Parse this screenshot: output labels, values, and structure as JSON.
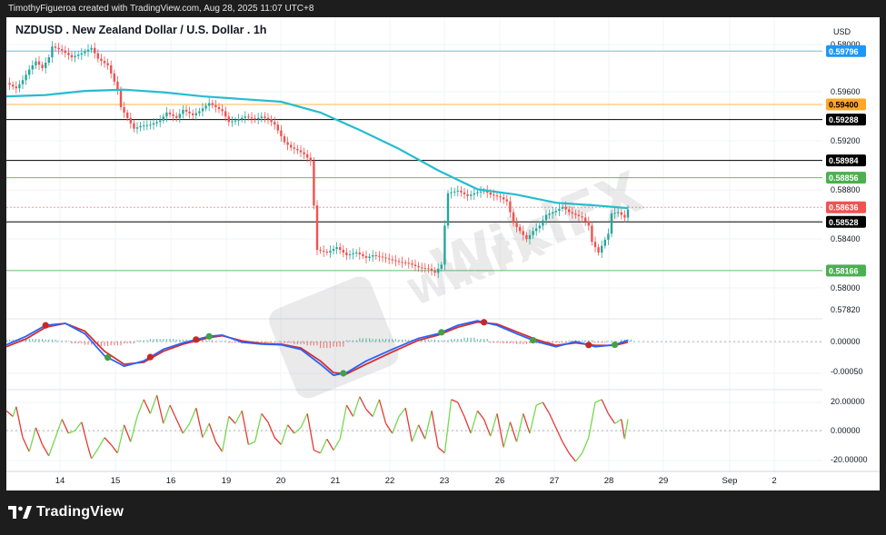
{
  "header": {
    "credit": "TimothyFigueroa created with TradingView.com, Aug 28, 2025 11:07 UTC+8",
    "symbol_title": "NZDUSD . New Zealand Dollar / U.S. Dollar . 1h",
    "currency": "USD"
  },
  "footer": {
    "brand": "TradingView"
  },
  "watermark": {
    "brand": "WikiFX"
  },
  "colors": {
    "up": "#26a69a",
    "down": "#ef5350",
    "ma": "#26bcd0",
    "macd_line": "#2962ff",
    "signal_line": "#d32f2f",
    "cross_down": "#c62828",
    "cross_up": "#43a047",
    "osc_up": "#76d94f",
    "osc_down": "#e53935"
  },
  "chart_data": [
    {
      "type": "candlestick",
      "title": "NZDUSD . New Zealand Dollar / U.S. Dollar . 1h",
      "ylabel": "USD",
      "ylim": [
        0.5772,
        0.583
      ],
      "x_ticks": [
        "14",
        "15",
        "16",
        "19",
        "20",
        "21",
        "22",
        "23",
        "26",
        "27",
        "28",
        "29",
        "Sep",
        "2"
      ],
      "y_ticks": [
        "0.58000",
        "0.59600",
        "0.59200",
        "0.58800",
        "0.58400",
        "0.58000",
        "0.57820"
      ],
      "price_series": [
        [
          0,
          0.5956
        ],
        [
          3,
          0.5952
        ],
        [
          5,
          0.5958
        ],
        [
          7,
          0.5966
        ],
        [
          9,
          0.5972
        ],
        [
          11,
          0.5967
        ],
        [
          13,
          0.5975
        ],
        [
          14,
          0.5983
        ],
        [
          17,
          0.598
        ],
        [
          20,
          0.5975
        ],
        [
          23,
          0.5978
        ],
        [
          26,
          0.5982
        ],
        [
          28,
          0.5974
        ],
        [
          31,
          0.5969
        ],
        [
          34,
          0.5951
        ],
        [
          35,
          0.5938
        ],
        [
          37,
          0.593
        ],
        [
          39,
          0.5922
        ],
        [
          41,
          0.5924
        ],
        [
          44,
          0.5925
        ],
        [
          47,
          0.5928
        ],
        [
          49,
          0.5934
        ],
        [
          52,
          0.593
        ],
        [
          54,
          0.5936
        ],
        [
          57,
          0.5932
        ],
        [
          59,
          0.5935
        ],
        [
          62,
          0.5941
        ],
        [
          64,
          0.5938
        ],
        [
          66,
          0.5935
        ],
        [
          68,
          0.5927
        ],
        [
          70,
          0.5928
        ],
        [
          73,
          0.5931
        ],
        [
          76,
          0.5929
        ],
        [
          78,
          0.5931
        ],
        [
          80,
          0.5929
        ],
        [
          82,
          0.5925
        ],
        [
          85,
          0.5912
        ],
        [
          87,
          0.5908
        ],
        [
          89,
          0.5906
        ],
        [
          91,
          0.5903
        ],
        [
          93,
          0.5898
        ],
        [
          94,
          0.5865
        ],
        [
          95,
          0.5832
        ],
        [
          98,
          0.583
        ],
        [
          101,
          0.5834
        ],
        [
          104,
          0.5828
        ],
        [
          107,
          0.583
        ],
        [
          110,
          0.5826
        ],
        [
          112,
          0.5828
        ],
        [
          114,
          0.5827
        ],
        [
          117,
          0.5825
        ],
        [
          120,
          0.5823
        ],
        [
          123,
          0.5822
        ],
        [
          126,
          0.5819
        ],
        [
          129,
          0.5818
        ],
        [
          131,
          0.5815
        ],
        [
          133,
          0.5821
        ],
        [
          134,
          0.585
        ],
        [
          135,
          0.5874
        ],
        [
          138,
          0.5876
        ],
        [
          141,
          0.5872
        ],
        [
          143,
          0.5874
        ],
        [
          146,
          0.5876
        ],
        [
          148,
          0.5873
        ],
        [
          151,
          0.5871
        ],
        [
          153,
          0.5868
        ],
        [
          155,
          0.5852
        ],
        [
          157,
          0.5846
        ],
        [
          159,
          0.584
        ],
        [
          161,
          0.5846
        ],
        [
          163,
          0.585
        ],
        [
          165,
          0.5858
        ],
        [
          168,
          0.5861
        ],
        [
          170,
          0.5864
        ],
        [
          172,
          0.586
        ],
        [
          174,
          0.5858
        ],
        [
          176,
          0.5856
        ],
        [
          178,
          0.585
        ],
        [
          179,
          0.5838
        ],
        [
          181,
          0.583
        ],
        [
          182,
          0.5835
        ],
        [
          184,
          0.5844
        ],
        [
          185,
          0.5859
        ],
        [
          187,
          0.586
        ],
        [
          189,
          0.5856
        ],
        [
          190,
          0.5862
        ]
      ],
      "moving_average": [
        [
          0,
          0.5946
        ],
        [
          12,
          0.5947
        ],
        [
          24,
          0.595
        ],
        [
          36,
          0.5951
        ],
        [
          48,
          0.5949
        ],
        [
          60,
          0.5946
        ],
        [
          72,
          0.5944
        ],
        [
          84,
          0.5942
        ],
        [
          96,
          0.5934
        ],
        [
          108,
          0.5921
        ],
        [
          120,
          0.5907
        ],
        [
          132,
          0.5891
        ],
        [
          144,
          0.5877
        ],
        [
          156,
          0.5873
        ],
        [
          168,
          0.5867
        ],
        [
          180,
          0.5865
        ],
        [
          190,
          0.5863
        ]
      ],
      "price_levels": [
        {
          "label": "0.59796",
          "price": 0.59796,
          "line_color": "#6fc0e8",
          "tag_color": "#2196f3",
          "text_color": "#ffffff"
        },
        {
          "label": "0.59400",
          "price": 0.594,
          "line_color": "#ffb74d",
          "tag_color": "#ffa726",
          "text_color": "#000000"
        },
        {
          "label": "0.59288",
          "price": 0.59288,
          "line_color": "#000000",
          "tag_color": "#000000",
          "text_color": "#ffffff"
        },
        {
          "label": "0.58984",
          "price": 0.58984,
          "line_color": "#000000",
          "tag_color": "#000000",
          "text_color": "#ffffff"
        },
        {
          "label": "0.58856",
          "price": 0.58856,
          "line_color": "#66bb6a",
          "tag_color": "#4caf50",
          "text_color": "#ffffff"
        },
        {
          "label": "0.58636",
          "price": 0.58636,
          "line_color": "#ef9a9a",
          "tag_color": "#ef5350",
          "text_color": "#ffffff",
          "dashed": true
        },
        {
          "label": "0.58528",
          "price": 0.58528,
          "line_color": "#000000",
          "tag_color": "#000000",
          "text_color": "#ffffff"
        },
        {
          "label": "0.58166",
          "price": 0.58166,
          "line_color": "#66bb6a",
          "tag_color": "#4caf50",
          "text_color": "#ffffff"
        }
      ]
    },
    {
      "type": "line",
      "ylim": [
        -0.00075,
        0.00045
      ],
      "y_ticks": [
        "0.00000",
        "-0.00050"
      ],
      "macd": [
        [
          0,
          -5e-05
        ],
        [
          6,
          8e-05
        ],
        [
          12,
          0.00025
        ],
        [
          18,
          0.00028
        ],
        [
          24,
          0.00012
        ],
        [
          30,
          -0.00022
        ],
        [
          36,
          -0.00038
        ],
        [
          42,
          -0.0003
        ],
        [
          48,
          -0.00012
        ],
        [
          54,
          -2e-05
        ],
        [
          62,
          8e-05
        ],
        [
          66,
          0.0001
        ],
        [
          72,
          -1e-05
        ],
        [
          78,
          -4e-05
        ],
        [
          84,
          -5e-05
        ],
        [
          90,
          -0.00012
        ],
        [
          96,
          -0.00035
        ],
        [
          100,
          -0.00052
        ],
        [
          104,
          -0.00048
        ],
        [
          110,
          -0.0003
        ],
        [
          118,
          -0.00012
        ],
        [
          126,
          5e-05
        ],
        [
          132,
          0.00012
        ],
        [
          138,
          0.00025
        ],
        [
          144,
          0.00032
        ],
        [
          150,
          0.00025
        ],
        [
          156,
          0.00012
        ],
        [
          162,
          0.0
        ],
        [
          168,
          -8e-05
        ],
        [
          174,
          0.0
        ],
        [
          180,
          -8e-05
        ],
        [
          186,
          -5e-05
        ],
        [
          190,
          2e-05
        ]
      ],
      "signal": [
        [
          0,
          -8e-05
        ],
        [
          6,
          4e-05
        ],
        [
          12,
          0.00022
        ],
        [
          18,
          0.00028
        ],
        [
          24,
          0.00016
        ],
        [
          30,
          -0.00015
        ],
        [
          36,
          -0.00035
        ],
        [
          42,
          -0.00032
        ],
        [
          48,
          -0.00015
        ],
        [
          54,
          -4e-05
        ],
        [
          62,
          6e-05
        ],
        [
          66,
          9e-05
        ],
        [
          72,
          1e-05
        ],
        [
          78,
          -3e-05
        ],
        [
          84,
          -4e-05
        ],
        [
          90,
          -0.0001
        ],
        [
          96,
          -0.0003
        ],
        [
          100,
          -0.00048
        ],
        [
          104,
          -0.0005
        ],
        [
          110,
          -0.00035
        ],
        [
          118,
          -0.00016
        ],
        [
          126,
          2e-05
        ],
        [
          132,
          0.0001
        ],
        [
          138,
          0.00022
        ],
        [
          144,
          0.0003
        ],
        [
          150,
          0.00027
        ],
        [
          156,
          0.00015
        ],
        [
          162,
          3e-05
        ],
        [
          168,
          -6e-05
        ],
        [
          174,
          -2e-05
        ],
        [
          180,
          -6e-05
        ],
        [
          186,
          -6e-05
        ],
        [
          190,
          -1e-05
        ]
      ],
      "histogram": [
        [
          0,
          3e-05
        ],
        [
          4,
          4e-05
        ],
        [
          8,
          4e-05
        ],
        [
          12,
          3e-05
        ],
        [
          16,
          1e-05
        ],
        [
          20,
          -3e-05
        ],
        [
          24,
          -5e-05
        ],
        [
          28,
          -7e-05
        ],
        [
          32,
          -6e-05
        ],
        [
          36,
          -3e-05
        ],
        [
          40,
          2e-05
        ],
        [
          44,
          4e-05
        ],
        [
          48,
          4e-05
        ],
        [
          52,
          3e-05
        ],
        [
          56,
          2e-05
        ],
        [
          60,
          2e-05
        ],
        [
          64,
          1e-05
        ],
        [
          68,
          -2e-05
        ],
        [
          72,
          -3e-05
        ],
        [
          76,
          -2e-05
        ],
        [
          80,
          -1e-05
        ],
        [
          84,
          -2e-05
        ],
        [
          88,
          -4e-05
        ],
        [
          92,
          -6e-05
        ],
        [
          96,
          -0.0001
        ],
        [
          100,
          -8e-05
        ],
        [
          104,
          2e-05
        ],
        [
          108,
          5e-05
        ],
        [
          112,
          4e-05
        ],
        [
          116,
          4e-05
        ],
        [
          120,
          3e-05
        ],
        [
          124,
          3e-05
        ],
        [
          128,
          3e-05
        ],
        [
          132,
          2e-05
        ],
        [
          136,
          4e-05
        ],
        [
          140,
          6e-05
        ],
        [
          144,
          4e-05
        ],
        [
          148,
          -2e-05
        ],
        [
          152,
          -3e-05
        ],
        [
          156,
          -4e-05
        ],
        [
          160,
          -3e-05
        ],
        [
          164,
          -2e-05
        ],
        [
          168,
          -2e-05
        ],
        [
          172,
          2e-05
        ],
        [
          176,
          2e-05
        ],
        [
          180,
          -2e-05
        ],
        [
          184,
          1e-05
        ],
        [
          188,
          3e-05
        ]
      ],
      "crosses_down": [
        12,
        44,
        58,
        146,
        178
      ],
      "crosses_up": [
        31,
        62,
        103,
        133,
        161,
        186
      ]
    },
    {
      "type": "line",
      "ylim": [
        -28,
        30
      ],
      "y_ticks": [
        "20.00000",
        "0.00000",
        "-20.00000"
      ],
      "oscillator": [
        [
          0,
          14
        ],
        [
          2,
          10
        ],
        [
          3,
          17
        ],
        [
          5,
          -5
        ],
        [
          7,
          -15
        ],
        [
          9,
          2
        ],
        [
          11,
          -10
        ],
        [
          13,
          -18
        ],
        [
          15,
          -5
        ],
        [
          17,
          8
        ],
        [
          19,
          -2
        ],
        [
          21,
          0
        ],
        [
          23,
          6
        ],
        [
          25,
          -12
        ],
        [
          26,
          -20
        ],
        [
          28,
          -13
        ],
        [
          30,
          -5
        ],
        [
          32,
          -10
        ],
        [
          34,
          -16
        ],
        [
          36,
          4
        ],
        [
          38,
          -8
        ],
        [
          40,
          10
        ],
        [
          42,
          22
        ],
        [
          44,
          12
        ],
        [
          46,
          25
        ],
        [
          48,
          5
        ],
        [
          50,
          18
        ],
        [
          52,
          8
        ],
        [
          54,
          -2
        ],
        [
          56,
          5
        ],
        [
          58,
          16
        ],
        [
          60,
          -5
        ],
        [
          62,
          5
        ],
        [
          64,
          -8
        ],
        [
          66,
          -15
        ],
        [
          68,
          10
        ],
        [
          70,
          5
        ],
        [
          72,
          14
        ],
        [
          74,
          -10
        ],
        [
          76,
          -8
        ],
        [
          78,
          12
        ],
        [
          80,
          6
        ],
        [
          82,
          -5
        ],
        [
          84,
          -10
        ],
        [
          86,
          4
        ],
        [
          88,
          -2
        ],
        [
          90,
          2
        ],
        [
          92,
          12
        ],
        [
          94,
          -14
        ],
        [
          96,
          -16
        ],
        [
          98,
          -6
        ],
        [
          100,
          -14
        ],
        [
          102,
          -6
        ],
        [
          104,
          18
        ],
        [
          106,
          10
        ],
        [
          108,
          24
        ],
        [
          110,
          15
        ],
        [
          112,
          10
        ],
        [
          114,
          22
        ],
        [
          116,
          5
        ],
        [
          118,
          -2
        ],
        [
          120,
          10
        ],
        [
          122,
          16
        ],
        [
          124,
          -8
        ],
        [
          126,
          4
        ],
        [
          128,
          -6
        ],
        [
          130,
          14
        ],
        [
          132,
          -12
        ],
        [
          134,
          -16
        ],
        [
          136,
          22
        ],
        [
          138,
          20
        ],
        [
          140,
          10
        ],
        [
          142,
          -2
        ],
        [
          144,
          14
        ],
        [
          146,
          8
        ],
        [
          148,
          -4
        ],
        [
          150,
          12
        ],
        [
          152,
          -12
        ],
        [
          154,
          6
        ],
        [
          156,
          -8
        ],
        [
          158,
          12
        ],
        [
          160,
          -2
        ],
        [
          162,
          18
        ],
        [
          164,
          20
        ],
        [
          166,
          12
        ],
        [
          168,
          2
        ],
        [
          170,
          -8
        ],
        [
          172,
          -16
        ],
        [
          174,
          -22
        ],
        [
          176,
          -16
        ],
        [
          178,
          -5
        ],
        [
          180,
          20
        ],
        [
          182,
          22
        ],
        [
          184,
          12
        ],
        [
          186,
          5
        ],
        [
          188,
          8
        ],
        [
          189,
          -6
        ],
        [
          190,
          8
        ]
      ]
    }
  ]
}
